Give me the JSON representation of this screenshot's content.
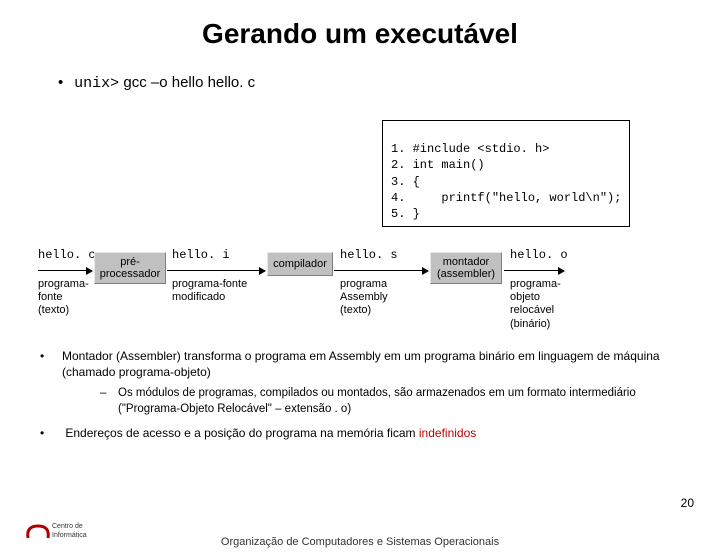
{
  "title": "Gerando um executável",
  "command": {
    "prompt": "unix>",
    "args": "gcc –o hello hello. c"
  },
  "code_lines": [
    "1. #include <stdio. h>",
    "2. int main()",
    "3. {",
    "4.     printf(\"hello, world\\n\");",
    "5. }"
  ],
  "pipeline": {
    "s0_file": "hello. c",
    "s0_sub": "programa-\nfonte\n(texto)",
    "p0": "pré-\nprocessador",
    "s1_file": "hello. i",
    "s1_sub": "programa-fonte\nmodificado",
    "p1": "compilador",
    "s2_file": "hello. s",
    "s2_sub": "programa\nAssembly\n(texto)",
    "p2": "montador\n(assembler)",
    "s3_file": "hello. o",
    "s3_sub": "programa-\nobjeto\nrelocável\n(binário)"
  },
  "bullets": {
    "b1": "Montador (Assembler) transforma o programa em Assembly em um programa binário em linguagem de máquina (chamado programa-objeto)",
    "sub1": "Os módulos de programas, compilados ou montados, são armazenados em um formato intermediário (\"Programa-Objeto Relocável\" – extensão . o)",
    "b2_a": "Endereços de acesso e a posição do programa na memória ficam ",
    "b2_b": "indefinidos"
  },
  "page_number": "20",
  "footer": "Organização de Computadores e Sistemas Operacionais",
  "logo_text": "Centro de\nInformática"
}
